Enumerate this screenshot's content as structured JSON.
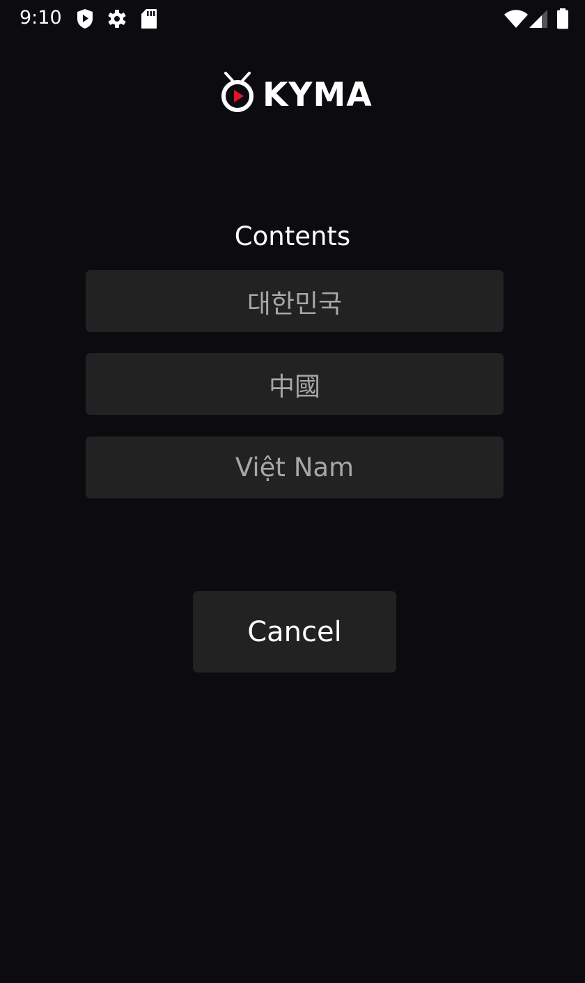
{
  "status_bar": {
    "time": "9:10",
    "left_icons": [
      "shield-play-icon",
      "gear-icon",
      "sd-card-icon"
    ],
    "right_icons": [
      "wifi-icon",
      "cellular-signal-icon",
      "battery-icon"
    ]
  },
  "brand": {
    "logo_text": "KYMA",
    "accent_color": "#e0142a"
  },
  "menu": {
    "title": "Contents",
    "options": [
      {
        "label": "대한민국"
      },
      {
        "label": "中國"
      },
      {
        "label": "Việt Nam"
      }
    ],
    "cancel_label": "Cancel"
  },
  "colors": {
    "background": "#0c0c10",
    "button_bg": "#222222",
    "option_text": "#a7a7a7",
    "primary_text": "#ffffff"
  }
}
